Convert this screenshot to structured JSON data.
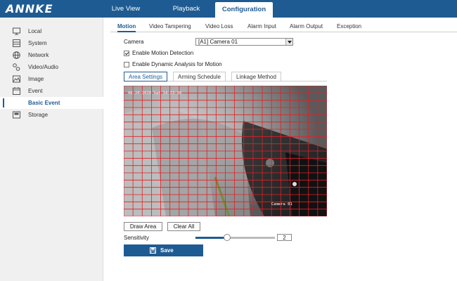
{
  "brand": {
    "logo": "ANNKE"
  },
  "top_nav": {
    "items": [
      {
        "label": "Live View"
      },
      {
        "label": "Playback"
      },
      {
        "label": "Configuration",
        "active": true
      }
    ]
  },
  "sidebar": {
    "items": [
      {
        "label": "Local",
        "icon": "monitor-icon"
      },
      {
        "label": "System",
        "icon": "server-icon"
      },
      {
        "label": "Network",
        "icon": "network-icon"
      },
      {
        "label": "Video/Audio",
        "icon": "video-audio-icon"
      },
      {
        "label": "Image",
        "icon": "image-icon"
      },
      {
        "label": "Event",
        "icon": "calendar-icon"
      },
      {
        "label": "Basic Event",
        "sub": true,
        "active": true
      },
      {
        "label": "Storage",
        "icon": "storage-icon"
      }
    ]
  },
  "event_tabs": {
    "items": [
      {
        "label": "Motion",
        "active": true
      },
      {
        "label": "Video Tampering"
      },
      {
        "label": "Video Loss"
      },
      {
        "label": "Alarm Input"
      },
      {
        "label": "Alarm Output"
      },
      {
        "label": "Exception"
      }
    ]
  },
  "camera": {
    "label": "Camera",
    "selected": "[A1] Camera 01"
  },
  "options": {
    "enable_motion": {
      "label": "Enable Motion Detection",
      "checked": true
    },
    "dynamic_analysis": {
      "label": "Enable Dynamic Analysis for Motion",
      "checked": false
    }
  },
  "area_tabs": {
    "items": [
      {
        "label": "Area Settings",
        "active": true
      },
      {
        "label": "Arming Schedule"
      },
      {
        "label": "Linkage Method"
      }
    ]
  },
  "video": {
    "osd_time": "06-20-2020 Sat 14:23:36",
    "osd_camera": "Camera 01",
    "grid_color": "#e0202a"
  },
  "buttons": {
    "draw_area": "Draw Area",
    "clear_all": "Clear All",
    "save": "Save"
  },
  "sensitivity": {
    "label": "Sensitivity",
    "value": "2",
    "level_fraction": 0.4
  },
  "colors": {
    "accent": "#1e5b92"
  }
}
